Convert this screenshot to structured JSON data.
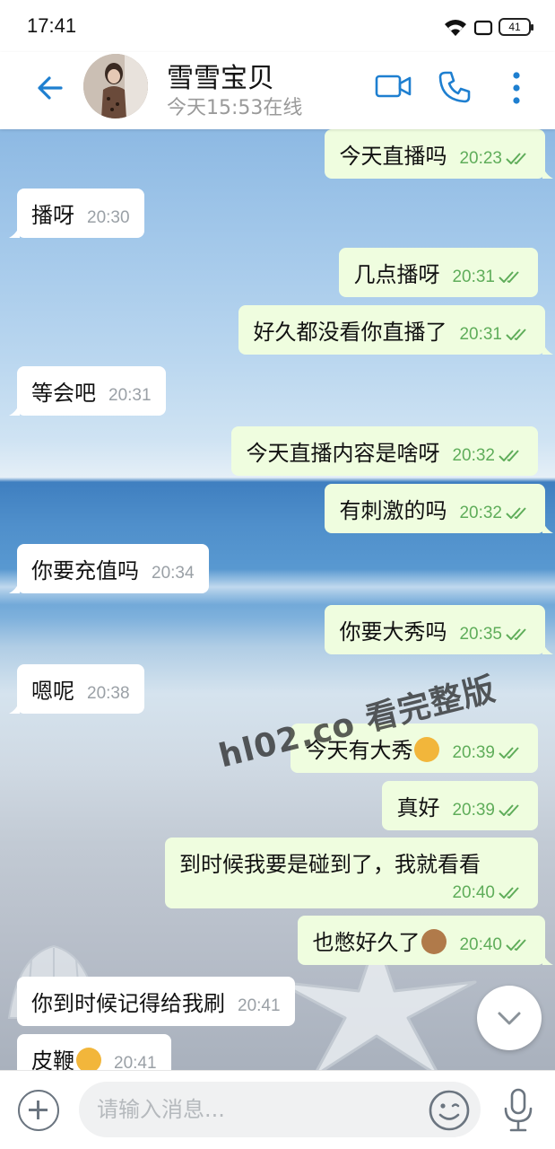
{
  "status_bar": {
    "time": "17:41",
    "battery": "41"
  },
  "header": {
    "name": "雪雪宝贝",
    "status": "今天15:53在线"
  },
  "messages": [
    {
      "dir": "out",
      "text": "今天直播吗",
      "time": "20:23"
    },
    {
      "dir": "in",
      "text": "播呀",
      "time": "20:30"
    },
    {
      "dir": "out",
      "text": "几点播呀",
      "time": "20:31"
    },
    {
      "dir": "out",
      "text": "好久都没看你直播了",
      "time": "20:31"
    },
    {
      "dir": "in",
      "text": "等会吧",
      "time": "20:31"
    },
    {
      "dir": "out",
      "text": "今天直播内容是啥呀",
      "time": "20:32"
    },
    {
      "dir": "out",
      "text": "有刺激的吗",
      "time": "20:32"
    },
    {
      "dir": "in",
      "text": "你要充值吗",
      "time": "20:34"
    },
    {
      "dir": "out",
      "text": "你要大秀吗",
      "time": "20:35"
    },
    {
      "dir": "in",
      "text": "嗯呢",
      "time": "20:38"
    },
    {
      "dir": "out",
      "text": "今天有大秀",
      "time": "20:39",
      "emoji": "smile-emoji"
    },
    {
      "dir": "out",
      "text": "真好",
      "time": "20:39"
    },
    {
      "dir": "out",
      "text": "到时候我要是碰到了，我就看看",
      "time": "20:40"
    },
    {
      "dir": "out",
      "text": "也憋好久了",
      "time": "20:40",
      "emoji": "see-no-evil-monkey-emoji"
    },
    {
      "dir": "in",
      "text": "你到时候记得给我刷",
      "time": "20:41"
    },
    {
      "dir": "in",
      "text": "皮鞭",
      "time": "20:41",
      "emoji": "thinking-emoji"
    }
  ],
  "watermark": "hl02.co 看完整版",
  "input": {
    "placeholder": "请输入消息..."
  },
  "colors": {
    "accent": "#1e7fd0",
    "outgoing_bubble": "#effddf",
    "incoming_bubble": "#ffffff",
    "tick": "#5fad5a"
  }
}
